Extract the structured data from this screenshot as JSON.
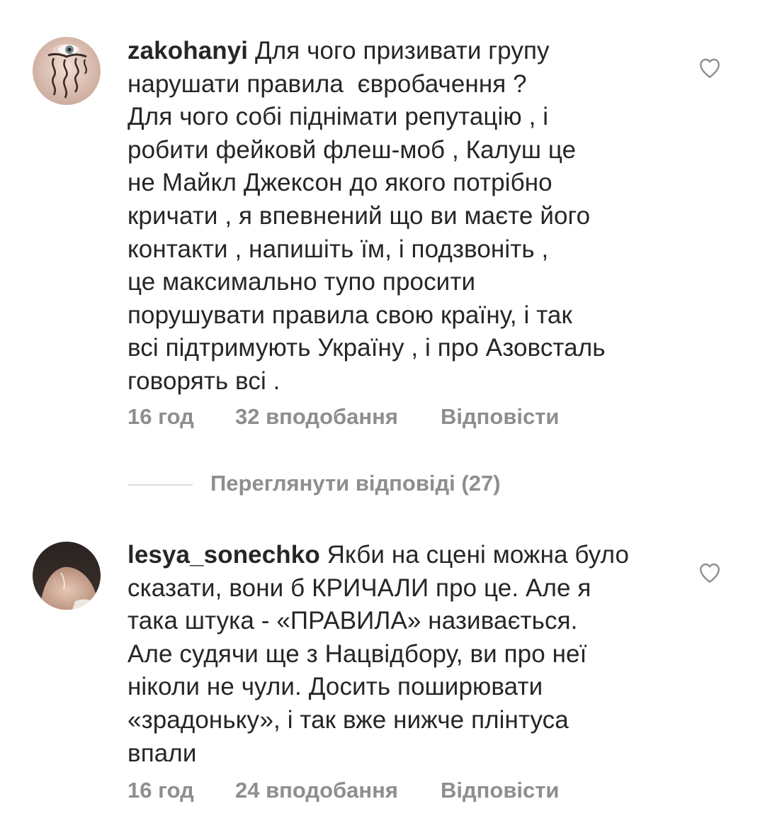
{
  "comments": [
    {
      "username": "zakohanyi",
      "text_lines": [
        "Для чого призивати групу",
        "нарушати правила  євробачення ?",
        "Для чого собі піднімати репутацію , і",
        "робити фейковй флеш-моб , Калуш це",
        "не Майкл Джексон до якого потрібно",
        "кричати , я впевнений що ви маєте його",
        "контакти , напишіть їм, і подзвоніть ,",
        "це максимально тупо просити",
        "порушувати правила свою країну, і так",
        "всі підтримують Україну , і про Азовсталь",
        "говорять всі ."
      ],
      "time": "16 год",
      "likes": "32 вподобання",
      "reply_label": "Відповісти",
      "avatar_icon": "avatar-eye-icon",
      "like_icon": "heart-outline-icon"
    },
    {
      "username": "lesya_sonechko",
      "text_lines": [
        "Якби на сцені можна було",
        "сказати, вони б КРИЧАЛИ про це. Але я",
        "така штука - «ПРАВИЛА» називається.",
        "Але судячи ще з Нацвідбору, ви про неї",
        "ніколи не чули. Досить поширювати",
        "«зрадоньку», і так вже нижче плінтуса",
        "впали"
      ],
      "time": "16 год",
      "likes": "24 вподобання",
      "reply_label": "Відповісти",
      "avatar_icon": "avatar-back-photo-icon",
      "like_icon": "heart-outline-icon"
    }
  ],
  "view_replies": {
    "label": "Переглянути відповіді (27)"
  },
  "colors": {
    "text": "#262626",
    "secondary": "#8e8e8e",
    "divider": "#dbdbdb"
  }
}
